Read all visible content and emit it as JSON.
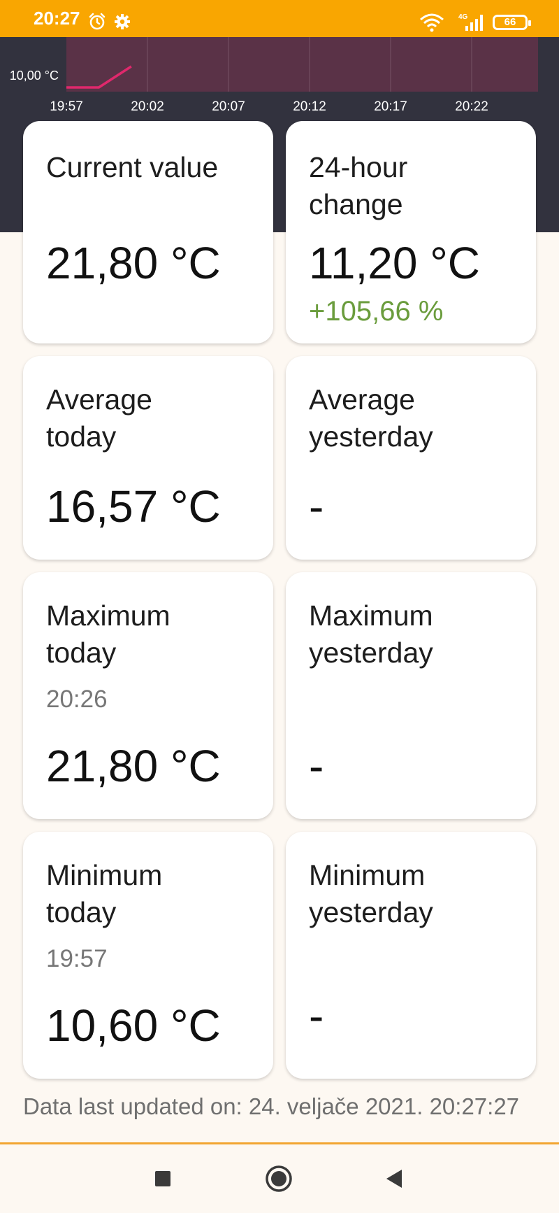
{
  "status_bar": {
    "time": "20:27",
    "battery": "66",
    "network": "4G",
    "icons": [
      "alarm-icon",
      "gear-icon",
      "wifi-icon",
      "signal-icon",
      "battery-icon"
    ]
  },
  "chart_data": {
    "type": "line",
    "y_tick_labels": [
      "10,00 °C"
    ],
    "x_tick_labels": [
      "19:57",
      "20:02",
      "20:07",
      "20:12",
      "20:17",
      "20:22"
    ],
    "series": [
      {
        "x": [
          "19:57",
          "19:59",
          "20:01"
        ],
        "y": [
          10.6,
          10.6,
          11.2
        ]
      }
    ],
    "grid": true,
    "colors": {
      "line": "#e0286c",
      "plot_bg": "#5a3247",
      "header_bg": "#32323e"
    }
  },
  "cards": [
    {
      "title": "Current value",
      "value": "21,80 °C"
    },
    {
      "title": "24-hour change",
      "value": "11,20 °C",
      "percent": "+105,66 %"
    },
    {
      "title": "Average today",
      "value": "16,57 °C"
    },
    {
      "title": "Average yesterday",
      "value": "-"
    },
    {
      "title": "Maximum today",
      "time": "20:26",
      "value": "21,80 °C"
    },
    {
      "title": "Maximum yesterday",
      "value": "-"
    },
    {
      "title": "Minimum today",
      "time": "19:57",
      "value": "10,60 °C"
    },
    {
      "title": "Minimum yesterday",
      "value": "-"
    }
  ],
  "footer": {
    "last_updated": "Data last updated on: 24. veljače 2021. 20:27:27"
  },
  "nav_bar": {
    "buttons": [
      "recents-button",
      "home-button",
      "back-button"
    ]
  },
  "colors": {
    "status_bar": "#f9a601",
    "page_bg": "#fdf8f2",
    "positive_change": "#6a9c3c",
    "accent_line": "#f2a531"
  }
}
